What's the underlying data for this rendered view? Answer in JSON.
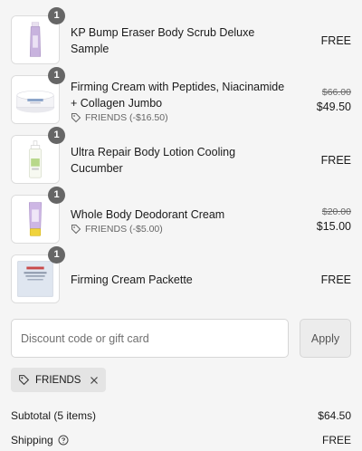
{
  "items": [
    {
      "quantity": "1",
      "title": "KP Bump Eraser Body Scrub Deluxe Sample",
      "discount": "",
      "old_price": "",
      "price": "FREE",
      "thumb": "purple-tube"
    },
    {
      "quantity": "1",
      "title": "Firming Cream with Peptides, Niacinamide + Collagen Jumbo",
      "discount": "FRIENDS (-$16.50)",
      "old_price": "$66.00",
      "price": "$49.50",
      "thumb": "white-jar"
    },
    {
      "quantity": "1",
      "title": "Ultra Repair Body Lotion Cooling Cucumber",
      "discount": "",
      "old_price": "",
      "price": "FREE",
      "thumb": "green-bottle"
    },
    {
      "quantity": "1",
      "title": "Whole Body Deodorant Cream",
      "discount": "FRIENDS (-$5.00)",
      "old_price": "$20.00",
      "price": "$15.00",
      "thumb": "purple-yellow-tube"
    },
    {
      "quantity": "1",
      "title": "Firming Cream Packette",
      "discount": "",
      "old_price": "",
      "price": "FREE",
      "thumb": "packet"
    }
  ],
  "discount": {
    "placeholder": "Discount code or gift card",
    "value": "",
    "apply_label": "Apply"
  },
  "applied_code": "FRIENDS",
  "summary": {
    "subtotal_label": "Subtotal (5 items)",
    "subtotal_value": "$64.50",
    "shipping_label": "Shipping",
    "shipping_value": "FREE"
  },
  "colors": {
    "background": "#f5f5f5",
    "badge": "#666666",
    "apply_bg": "#ececec",
    "tag_bg": "#e4e4e4"
  }
}
